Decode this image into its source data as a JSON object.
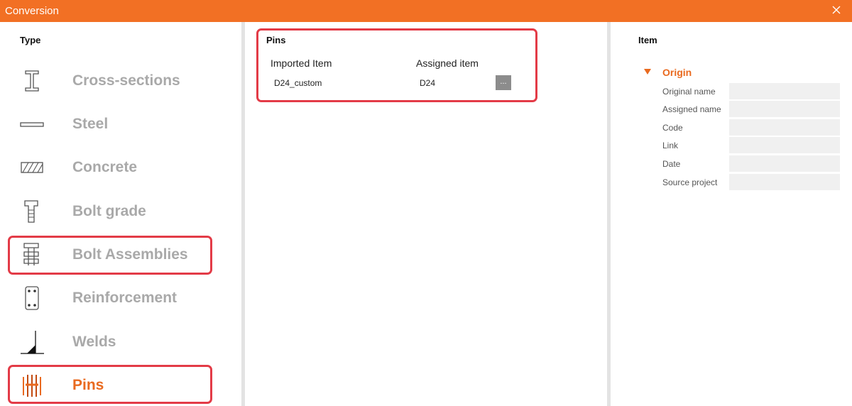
{
  "window": {
    "title": "Conversion",
    "close_icon": "close-icon"
  },
  "type_panel": {
    "heading": "Type",
    "items": [
      {
        "label": "Cross-sections",
        "icon": "i-beam-icon"
      },
      {
        "label": "Steel",
        "icon": "plate-icon"
      },
      {
        "label": "Concrete",
        "icon": "hatched-section-icon"
      },
      {
        "label": "Bolt grade",
        "icon": "bolt-icon"
      },
      {
        "label": "Bolt Assemblies",
        "icon": "bolt-assembly-icon"
      },
      {
        "label": "Reinforcement",
        "icon": "reinforced-section-icon"
      },
      {
        "label": "Welds",
        "icon": "weld-icon"
      },
      {
        "label": "Pins",
        "icon": "pin-icon",
        "selected": true
      }
    ]
  },
  "pins_panel": {
    "heading": "Pins",
    "columns": [
      "Imported Item",
      "Assigned item"
    ],
    "rows": [
      {
        "imported": "D24_custom",
        "assigned": "D24",
        "browse_label": "..."
      }
    ]
  },
  "item_panel": {
    "heading": "Item",
    "group": {
      "label": "Origin",
      "expanded": true
    },
    "properties": [
      {
        "label": "Original name",
        "value": ""
      },
      {
        "label": "Assigned name",
        "value": ""
      },
      {
        "label": "Code",
        "value": ""
      },
      {
        "label": "Link",
        "value": ""
      },
      {
        "label": "Date",
        "value": ""
      },
      {
        "label": "Source project",
        "value": ""
      }
    ]
  },
  "colors": {
    "accent": "#f27024",
    "highlight": "#e33b47",
    "inactive_text": "#a9a9a9",
    "field_bg": "#f0f0f0"
  }
}
